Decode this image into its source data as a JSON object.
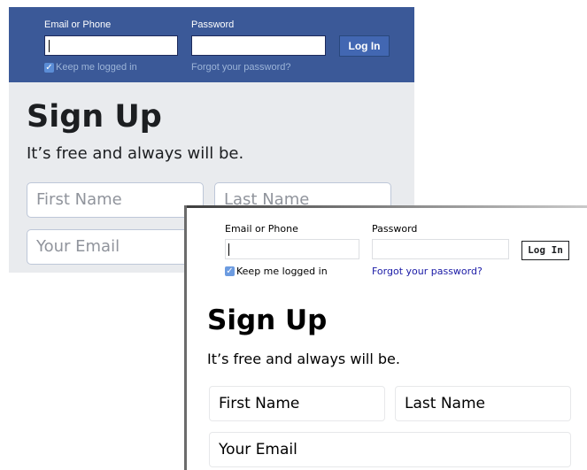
{
  "colors": {
    "header_blue": "#3b5998",
    "panel_bg": "#e9ebee",
    "link_blue": "#1a1aa6"
  },
  "panel_styled": {
    "login": {
      "email_label": "Email or Phone",
      "password_label": "Password",
      "login_button": "Log In",
      "keep_logged_in": "Keep me logged in",
      "forgot_password": "Forgot your password?"
    },
    "signup": {
      "title": "Sign Up",
      "tagline": "It’s free and always will be.",
      "first_name_placeholder": "First Name",
      "last_name_placeholder": "Last Name",
      "email_placeholder": "Your Email"
    }
  },
  "panel_plain": {
    "login": {
      "email_label": "Email or Phone",
      "password_label": "Password",
      "login_button": "Log In",
      "keep_logged_in": "Keep me logged in",
      "forgot_password": "Forgot your password?"
    },
    "signup": {
      "title": "Sign Up",
      "tagline": "It’s free and always will be.",
      "first_name_placeholder": "First Name",
      "last_name_placeholder": "Last Name",
      "email_placeholder": "Your Email"
    }
  }
}
